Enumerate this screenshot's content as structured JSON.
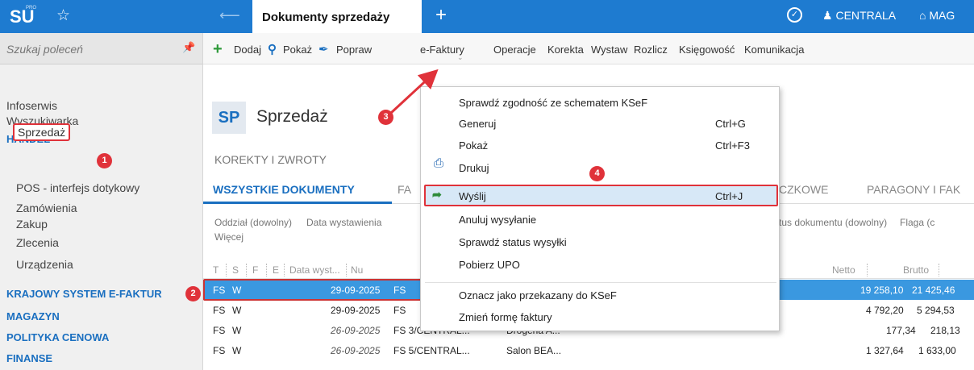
{
  "app": {
    "logo": "SU",
    "logo_sup": "PRO",
    "tab_title": "Dokumenty sprzedaży",
    "company": "CENTRALA",
    "warehouse": "MAG"
  },
  "sidebar": {
    "search_placeholder": "Szukaj poleceń",
    "items": [
      {
        "label": "Infoserwis"
      },
      {
        "label": "Wyszukiwarka"
      }
    ],
    "handel": {
      "header": "HANDEL",
      "sub": [
        "Sprzedaż",
        "POS - interfejs dotykowy",
        "Zamówienia",
        "Zakup",
        "Zlecenia",
        "Urządzenia"
      ]
    },
    "sections": [
      "KRAJOWY SYSTEM E-FAKTUR",
      "MAGAZYN",
      "POLITYKA CENOWA",
      "FINANSE"
    ]
  },
  "toolbar": {
    "add": "Dodaj",
    "show": "Pokaż",
    "fix": "Popraw",
    "efaktury": "e-Faktury",
    "operacje": "Operacje",
    "korekta": "Korekta",
    "wystaw": "Wystaw",
    "rozlicz": "Rozlicz",
    "ksiegowosc": "Księgowość",
    "komunikacja": "Komunikacja"
  },
  "page": {
    "badge": "SP",
    "title": "Sprzedaż",
    "section": "KOREKTY I ZWROTY",
    "tabs": [
      "WSZYSTKIE DOKUMENTY",
      "FA",
      "CZKOWE",
      "PARAGONY I FAK"
    ],
    "filters": [
      "Oddział (dowolny)",
      "Data wystawienia",
      "Więcej",
      "tus dokumentu (dowolny)",
      "Flaga (c"
    ]
  },
  "table": {
    "headers": [
      "T",
      "S",
      "F",
      "E",
      "Data wyst...",
      "Nu",
      "Netto",
      "Brutto"
    ],
    "rows": [
      {
        "t": "FS",
        "s": "W",
        "date": "29-09-2025",
        "num": "FS",
        "client": "",
        "netto": "19 258,10",
        "brutto": "21 425,46"
      },
      {
        "t": "FS",
        "s": "W",
        "date": "29-09-2025",
        "num": "FS",
        "client": "",
        "netto": "4 792,20",
        "brutto": "5 294,53"
      },
      {
        "t": "FS",
        "s": "W",
        "date": "26-09-2025",
        "num": "FS 3/CENTRAL...",
        "client": "Drogeria A...",
        "netto": "177,34",
        "brutto": "218,13"
      },
      {
        "t": "FS",
        "s": "W",
        "date": "26-09-2025",
        "num": "FS 5/CENTRAL...",
        "client": "Salon BEA...",
        "netto": "1 327,64",
        "brutto": "1 633,00"
      }
    ]
  },
  "menu": {
    "items": [
      {
        "label": "Sprawdź zgodność ze schematem KSeF",
        "shortcut": ""
      },
      {
        "label": "Generuj",
        "shortcut": "Ctrl+G"
      },
      {
        "label": "Pokaż",
        "shortcut": "Ctrl+F3"
      },
      {
        "label": "Drukuj",
        "shortcut": ""
      },
      {
        "label": "Wyślij",
        "shortcut": "Ctrl+J"
      },
      {
        "label": "Anuluj wysyłanie",
        "shortcut": ""
      },
      {
        "label": "Sprawdź status wysyłki",
        "shortcut": ""
      },
      {
        "label": "Pobierz UPO",
        "shortcut": ""
      },
      {
        "label": "Oznacz jako przekazany do KSeF",
        "shortcut": ""
      },
      {
        "label": "Zmień formę faktury",
        "shortcut": ""
      }
    ]
  },
  "annotations": [
    "1",
    "2",
    "3",
    "4"
  ],
  "colors": {
    "topbar": "#1e7bd0",
    "accent": "#1a6fc0",
    "selected_row": "#3a98e0",
    "highlight": "#e0323a"
  }
}
